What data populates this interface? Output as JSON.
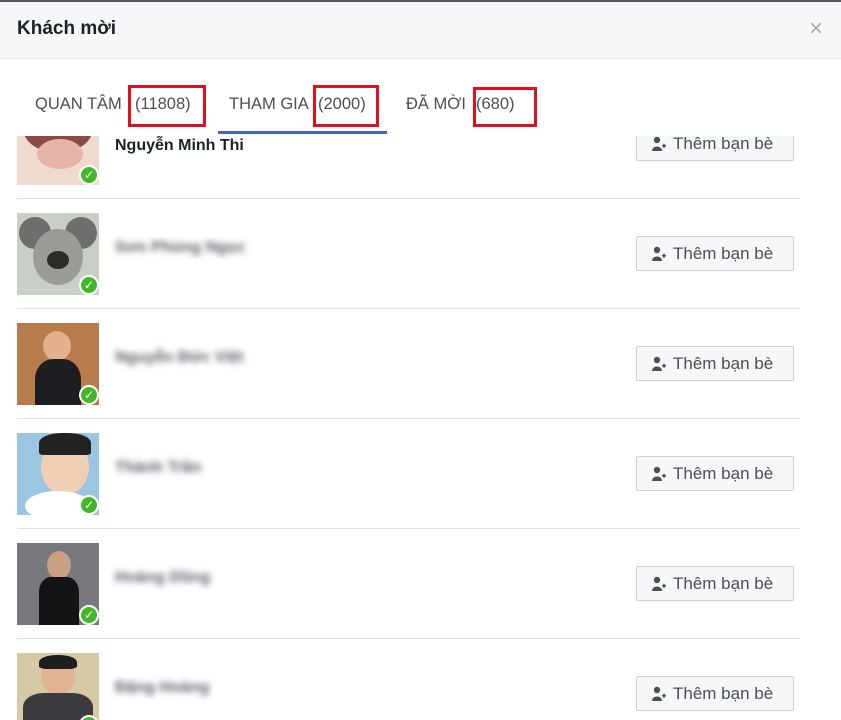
{
  "dialog": {
    "title": "Khách mời",
    "close": "×"
  },
  "tabs": [
    {
      "label": "QUAN TÂM",
      "count": "(11808)"
    },
    {
      "label": "THAM GIA",
      "count": "(2000)"
    },
    {
      "label": "ĐÃ MỜI",
      "count": "(680)"
    }
  ],
  "active_tab": "THAM GIA",
  "colors": {
    "accent": "#4267b2",
    "highlight": "#e0101e",
    "check": "#42b72a"
  },
  "add_friend_label": "Thêm bạn bè",
  "guests": [
    {
      "name": "Nguyễn Minh Thi",
      "legible": "partial"
    },
    {
      "name": "Sơn Phùng Ngọc",
      "legible": "blurred"
    },
    {
      "name": "Nguyễn Đức Việt",
      "legible": "blurred"
    },
    {
      "name": "Thành Trần",
      "legible": "blurred"
    },
    {
      "name": "Hoàng Dũng",
      "legible": "blurred"
    },
    {
      "name": "Đặng Hoàng",
      "legible": "blurred"
    }
  ]
}
